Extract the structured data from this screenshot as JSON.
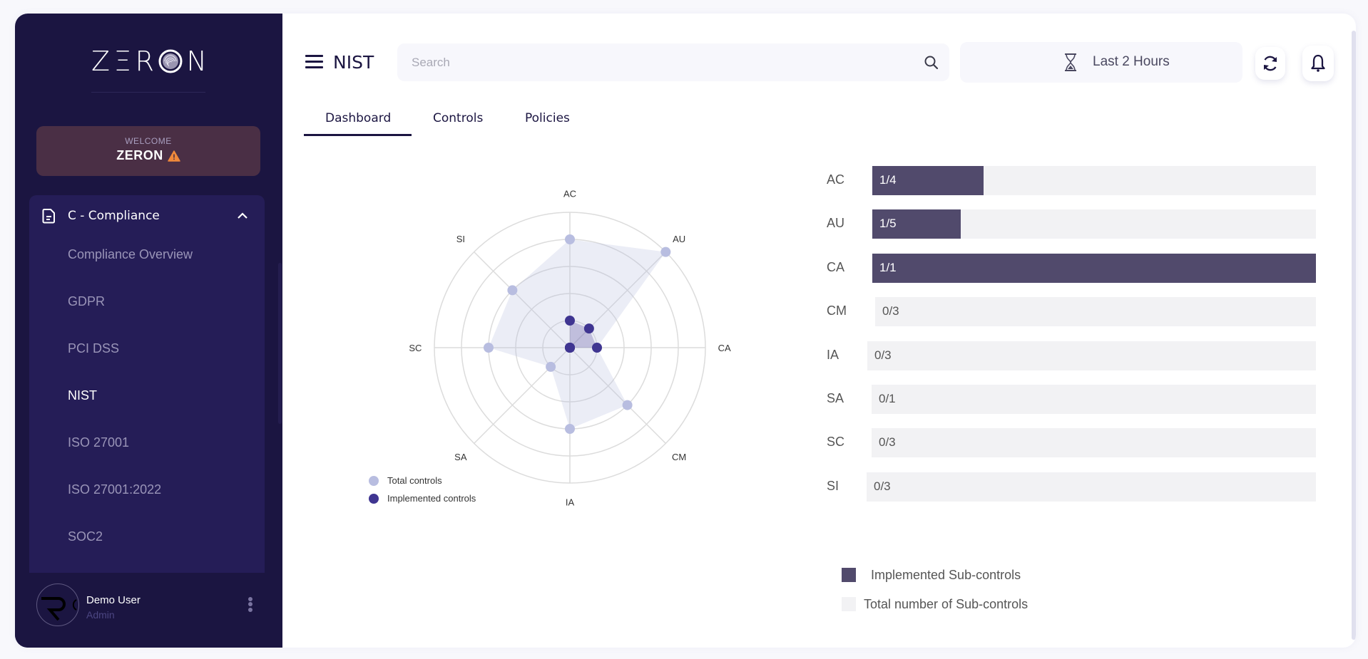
{
  "brand": {
    "logo_text": [
      "Z",
      "Ξ",
      "R",
      "O",
      "N"
    ],
    "accent": "#1b1541"
  },
  "welcome": {
    "label": "WELCOME",
    "name": "ZERON",
    "warning_icon": "warning-triangle-icon"
  },
  "sidebar": {
    "group": {
      "label": "C - Compliance",
      "icon": "document-icon",
      "expanded": true
    },
    "items": [
      {
        "label": "Compliance Overview",
        "active": false
      },
      {
        "label": "GDPR",
        "active": false
      },
      {
        "label": "PCI DSS",
        "active": false
      },
      {
        "label": "NIST",
        "active": true
      },
      {
        "label": "ISO 27001",
        "active": false
      },
      {
        "label": "ISO 27001:2022",
        "active": false
      },
      {
        "label": "SOC2",
        "active": false
      }
    ],
    "user": {
      "name": "Demo User",
      "role": "Admin"
    }
  },
  "header": {
    "title": "NIST",
    "search_placeholder": "Search",
    "search_value": "",
    "time_range": "Last 2 Hours"
  },
  "tabs": [
    {
      "label": "Dashboard",
      "active": true
    },
    {
      "label": "Controls",
      "active": false
    },
    {
      "label": "Policies",
      "active": false
    }
  ],
  "chart_data": [
    {
      "type": "radar",
      "categories": [
        "AC",
        "AU",
        "CA",
        "CM",
        "IA",
        "SA",
        "SC",
        "SI"
      ],
      "series": [
        {
          "name": "Total controls",
          "values": [
            4,
            5,
            1,
            3,
            3,
            1,
            3,
            3
          ],
          "color": "#b8bde0"
        },
        {
          "name": "Implemented controls",
          "values": [
            1,
            1,
            1,
            0,
            0,
            0,
            0,
            0
          ],
          "color": "#3f3591"
        }
      ],
      "r_range": [
        0,
        5
      ],
      "ring_count": 5,
      "legend": "bottom-left",
      "grid": true
    },
    {
      "type": "bar",
      "orientation": "horizontal",
      "categories": [
        "AC",
        "AU",
        "CA",
        "CM",
        "IA",
        "SA",
        "SC",
        "SI"
      ],
      "series": [
        {
          "name": "Implemented Sub-controls",
          "values": [
            1,
            1,
            1,
            0,
            0,
            0,
            0,
            0
          ],
          "color": "#514a6c"
        },
        {
          "name": "Total number of Sub-controls",
          "values": [
            4,
            5,
            1,
            3,
            3,
            1,
            3,
            3
          ],
          "color": "#f2f2f4"
        }
      ],
      "data_labels": [
        "1/4",
        "1/5",
        "1/1",
        "0/3",
        "0/3",
        "0/1",
        "0/3",
        "0/3"
      ],
      "legend": "bottom-left"
    }
  ]
}
